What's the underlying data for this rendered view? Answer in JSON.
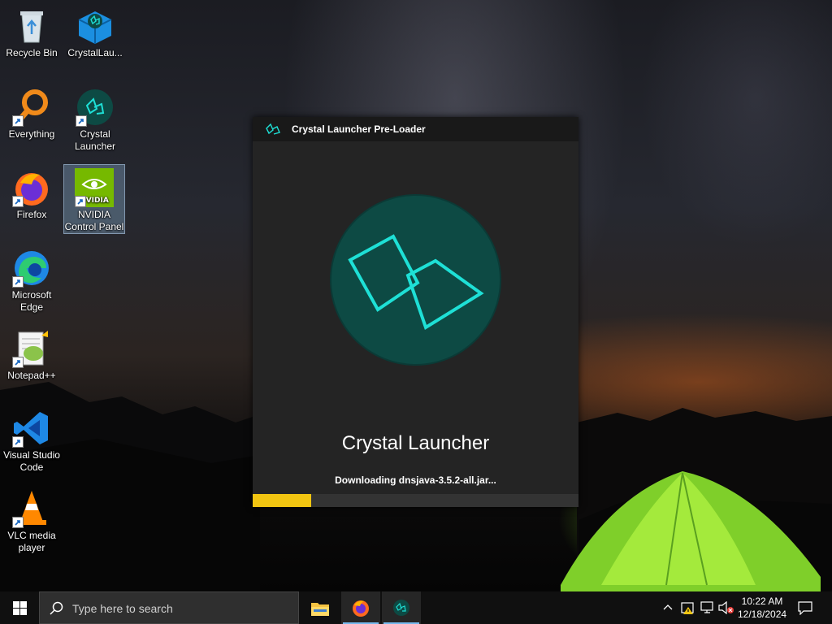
{
  "desktop": {
    "icons": [
      {
        "label": "Recycle Bin",
        "icon": "recycle-bin-icon"
      },
      {
        "label": "CrystalLau...",
        "icon": "package-box-icon"
      },
      {
        "label": "Everything",
        "icon": "magnifier-icon"
      },
      {
        "label": "Crystal Launcher",
        "icon": "crystal-launcher-icon"
      },
      {
        "label": "Firefox",
        "icon": "firefox-icon"
      },
      {
        "label": "NVIDIA Control Panel",
        "icon": "nvidia-icon",
        "selected": true
      },
      {
        "label": "Microsoft Edge",
        "icon": "edge-icon"
      },
      {
        "label": "Notepad++",
        "icon": "notepadpp-icon"
      },
      {
        "label": "Visual Studio Code",
        "icon": "vscode-icon"
      },
      {
        "label": "VLC media player",
        "icon": "vlc-icon"
      }
    ]
  },
  "preloader": {
    "title": "Crystal Launcher Pre-Loader",
    "app_name": "Crystal Launcher",
    "status": "Downloading dnsjava-3.5.2-all.jar...",
    "progress": 0.18,
    "colors": {
      "accent": "#f2c511",
      "logo_bg": "#0d4a44",
      "logo_stroke": "#1ee0d6"
    }
  },
  "taskbar": {
    "search_placeholder": "Type here to search",
    "apps": [
      "file-explorer-icon",
      "firefox-icon",
      "crystal-launcher-icon"
    ],
    "time": "10:22 AM",
    "date": "12/18/2024"
  }
}
